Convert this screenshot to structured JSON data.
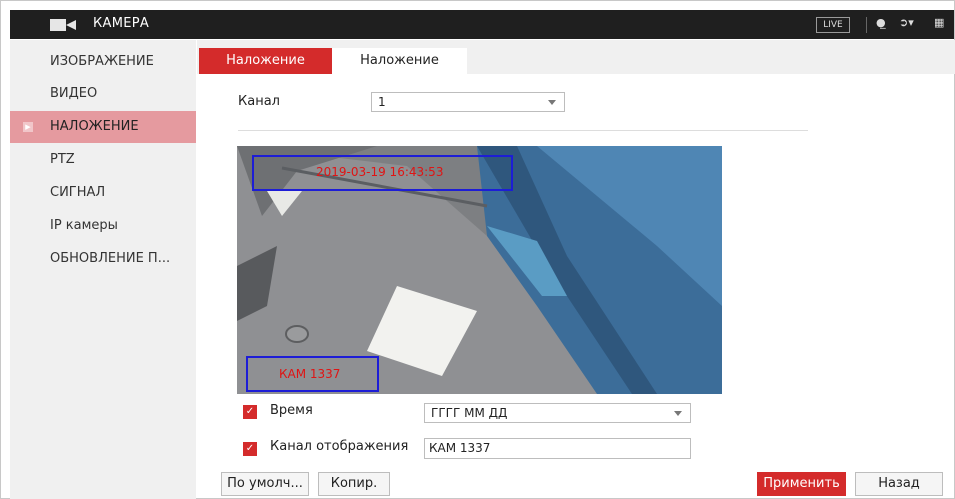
{
  "header": {
    "title": "КАМЕРА",
    "live_label": "LIVE"
  },
  "icons": {
    "camera": "camera-icon",
    "user": "user-icon",
    "logout": "logout-icon",
    "qr": "qr-code-icon"
  },
  "sidebar": {
    "items": [
      {
        "label": "ИЗОБРАЖЕНИЕ"
      },
      {
        "label": "ВИДЕО"
      },
      {
        "label": "НАЛОЖЕНИЕ",
        "active": true
      },
      {
        "label": "PTZ"
      },
      {
        "label": "СИГНАЛ"
      },
      {
        "label": "IP камеры"
      },
      {
        "label": "ОБНОВЛЕНИЕ П..."
      }
    ]
  },
  "tabs": [
    {
      "label": "Наложение",
      "active": true
    },
    {
      "label": "Наложение",
      "active": false
    }
  ],
  "channel": {
    "label": "Канал",
    "value": "1"
  },
  "preview": {
    "timestamp_text": "2019-03-19 16:43:53",
    "name_text": "КАМ 1337"
  },
  "time_option": {
    "label": "Время",
    "checked": true,
    "format_value": "ГГГГ ММ ДД"
  },
  "channel_display": {
    "label": "Канал отображения",
    "checked": true,
    "value": "КАМ 1337"
  },
  "buttons": {
    "default": "По умолч...",
    "copy": "Копир.",
    "apply": "Применить",
    "back": "Назад"
  },
  "colors": {
    "accent": "#d42b2b",
    "active_sidebar": "#e59a9f",
    "overlay_box": "#1d1dd6",
    "overlay_text": "#e01414"
  }
}
